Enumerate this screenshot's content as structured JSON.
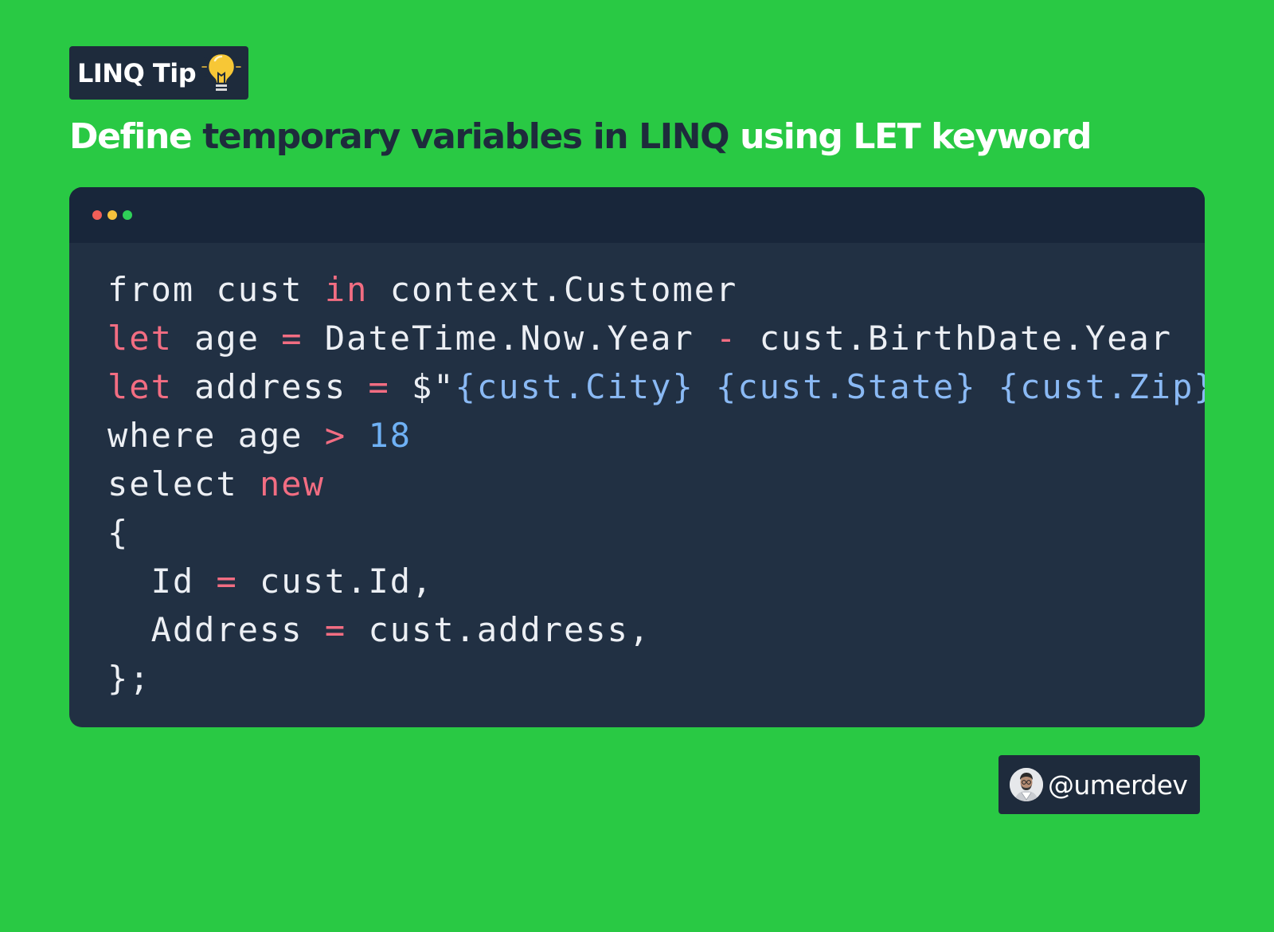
{
  "badge": {
    "label": "LINQ Tip",
    "icon": "lightbulb-icon"
  },
  "title": {
    "parts": [
      "Define ",
      "temporary variables in LINQ ",
      "using LET keyword"
    ]
  },
  "code": {
    "window_controls": [
      "red",
      "yellow",
      "green"
    ],
    "lines": [
      [
        "from cust ",
        "in",
        " context.Customer"
      ],
      [
        "let",
        " age ",
        "=",
        " DateTime.Now.Year ",
        "-",
        " cust.BirthDate.Year"
      ],
      [
        "let",
        " address ",
        "=",
        " $\"",
        "{cust.City}",
        " ",
        "{cust.State}",
        " ",
        "{cust.Zip}",
        "\""
      ],
      [
        "where age ",
        ">",
        " ",
        "18"
      ],
      [
        "select ",
        "new"
      ],
      [
        "{"
      ],
      [
        "  Id ",
        "=",
        " cust.Id,"
      ],
      [
        "  Address ",
        "=",
        " cust.address,"
      ],
      [
        "};"
      ]
    ]
  },
  "author": {
    "handle": "@umerdev",
    "avatar_icon": "avatar"
  },
  "colors": {
    "background": "#29c944",
    "panel": "#1e2b3c",
    "code_bg": "#213043",
    "keyword": "#f26d82",
    "number": "#6fb1f5",
    "interpolation": "#8ab9f4"
  }
}
